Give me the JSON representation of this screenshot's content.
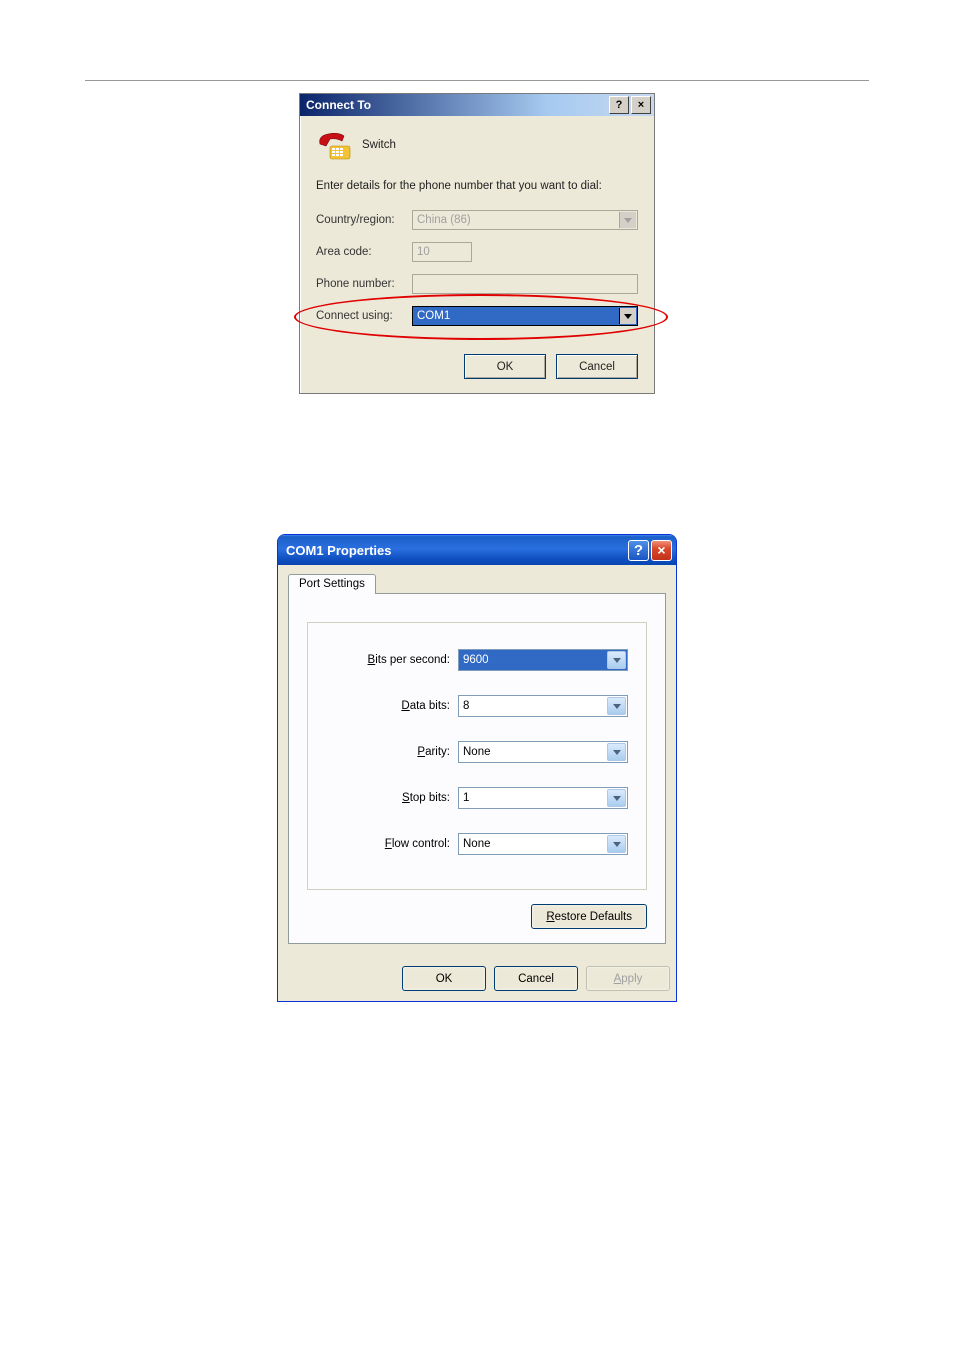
{
  "dialog1": {
    "title": "Connect To",
    "icon_name": "Switch",
    "instruction": "Enter details for the phone number that you want to dial:",
    "country_label": "Country/region:",
    "country_value": "China (86)",
    "area_label": "Area code:",
    "area_value": "10",
    "phone_label": "Phone number:",
    "phone_value": "",
    "connect_label": "Connect using:",
    "connect_value": "COM1",
    "ok": "OK",
    "cancel": "Cancel",
    "help_symbol": "?",
    "close_symbol": "×"
  },
  "dialog2": {
    "title": "COM1 Properties",
    "tab": "Port Settings",
    "bits_label_pre": "B",
    "bits_label_rest": "its per second:",
    "bits_value": "9600",
    "data_label_pre": "D",
    "data_label_rest": "ata bits:",
    "data_value": "8",
    "parity_label_pre": "P",
    "parity_label_rest": "arity:",
    "parity_value": "None",
    "stop_label_pre": "S",
    "stop_label_rest": "top bits:",
    "stop_value": "1",
    "flow_label_pre": "F",
    "flow_label_rest": "low control:",
    "flow_value": "None",
    "restore_pre": "R",
    "restore_rest": "estore Defaults",
    "ok": "OK",
    "cancel": "Cancel",
    "apply_pre": "A",
    "apply_rest": "pply",
    "help_symbol": "?",
    "close_symbol": "×"
  }
}
